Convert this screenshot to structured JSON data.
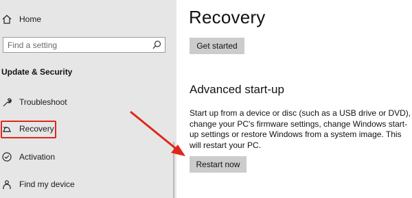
{
  "sidebar": {
    "home_label": "Home",
    "search_placeholder": "Find a setting",
    "section_title": "Update & Security",
    "items": [
      {
        "label": "Troubleshoot",
        "icon": "wrench-icon"
      },
      {
        "label": "Recovery",
        "icon": "recovery-icon"
      },
      {
        "label": "Activation",
        "icon": "check-circle-icon"
      },
      {
        "label": "Find my device",
        "icon": "person-pin-icon"
      }
    ]
  },
  "main": {
    "title": "Recovery",
    "get_started_label": "Get started",
    "advanced_title": "Advanced start-up",
    "advanced_description": "Start up from a device or disc (such as a USB drive or DVD), change your PC's firmware settings, change Windows start-up settings or restore Windows from a system image. This will restart your PC.",
    "restart_label": "Restart now"
  },
  "annotation": {
    "color": "#e0261a"
  }
}
